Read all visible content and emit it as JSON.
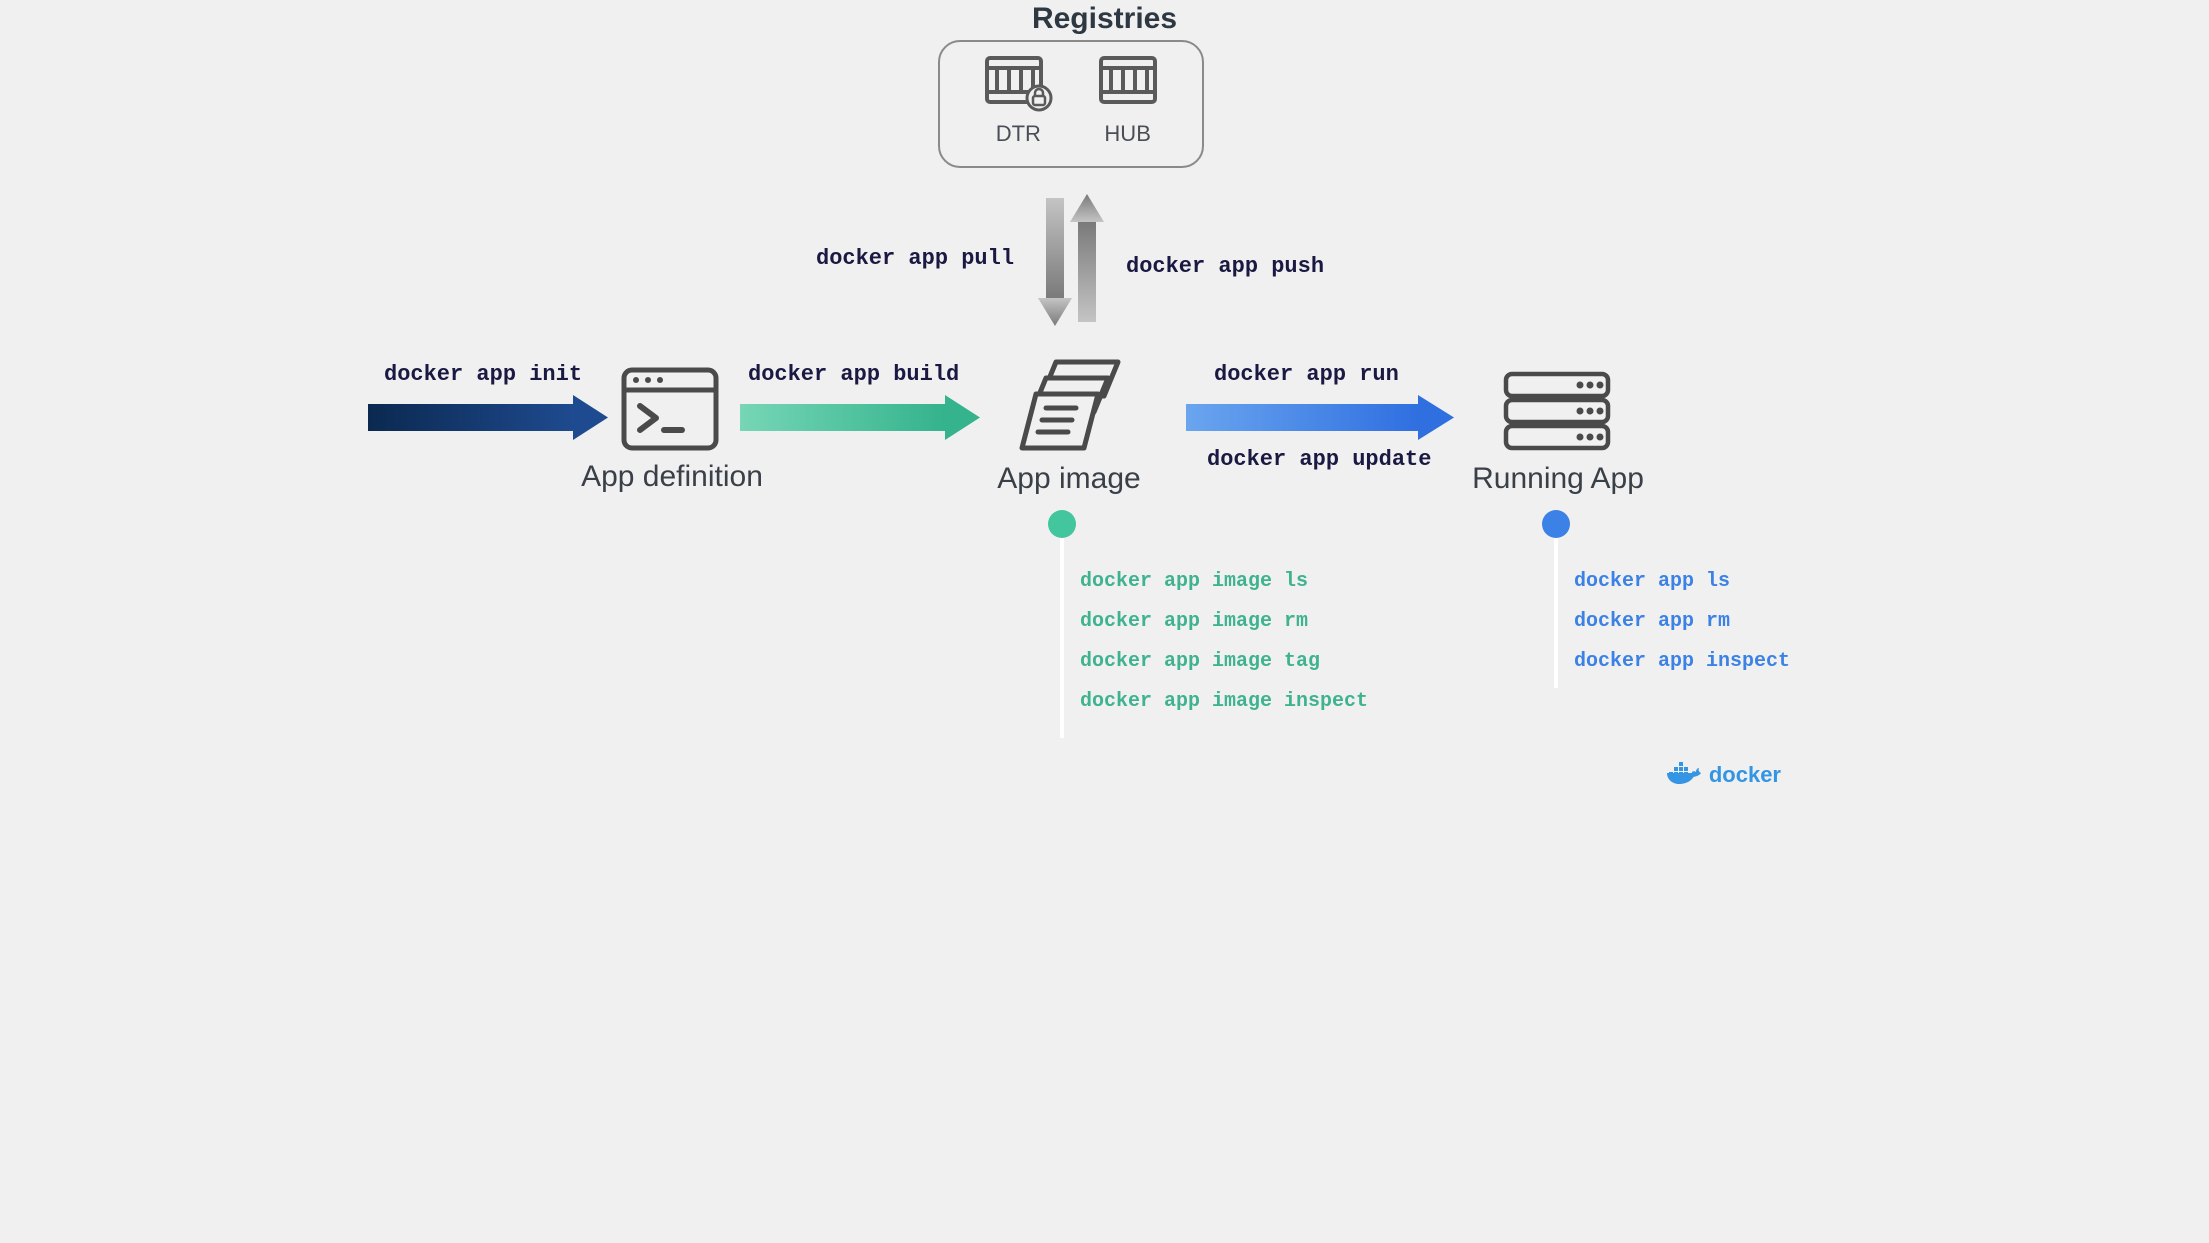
{
  "registries": {
    "title": "Registries",
    "items": [
      {
        "label": "DTR"
      },
      {
        "label": "HUB"
      }
    ]
  },
  "pull_cmd": "docker app pull",
  "push_cmd": "docker app push",
  "flow": {
    "init_cmd": "docker app init",
    "build_cmd": "docker app build",
    "run_cmd": "docker app run",
    "update_cmd": "docker app update",
    "nodes": {
      "app_definition": "App definition",
      "app_image": "App image",
      "running_app": "Running App"
    }
  },
  "image_cmds": [
    "docker app image ls",
    "docker app image rm",
    "docker app image tag",
    "docker app image inspect"
  ],
  "running_cmds": [
    "docker app ls",
    "docker app rm",
    "docker app inspect"
  ],
  "brand": "docker",
  "colors": {
    "navy": "#17376b",
    "green": "#43c59e",
    "blue": "#3c82e6",
    "text": "#3a4048"
  }
}
